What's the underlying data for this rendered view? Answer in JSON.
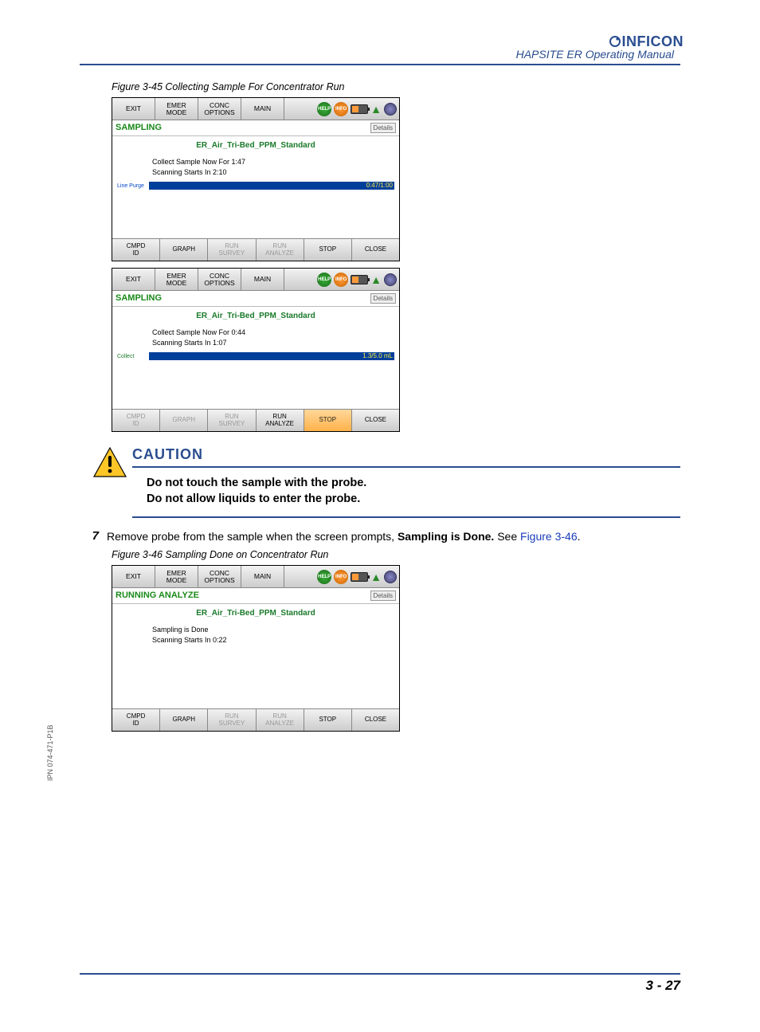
{
  "header": {
    "doc_title": "HAPSITE ER Operating Manual",
    "brand": "INFICON"
  },
  "fig45": {
    "caption": "Figure 3-45  Collecting Sample For Concentrator Run",
    "top_tabs": [
      "EXIT",
      "EMER\nMODE",
      "CONC\nOPTIONS",
      "MAIN"
    ],
    "details_label": "Details",
    "method": "ER_Air_Tri-Bed_PPM_Standard",
    "bottom_tabs": {
      "cmpd_id": "CMPD\nID",
      "graph": "GRAPH",
      "run_survey": "RUN\nSURVEY",
      "run_analyze": "RUN\nANALYZE",
      "stop": "STOP",
      "close": "CLOSE"
    },
    "shot_a": {
      "status": "SAMPLING",
      "line1": "Collect Sample Now For  1:47",
      "line2": "Scanning Starts In  2:10",
      "prog_label": "Line Purge",
      "prog_readout": "0:47/1:00"
    },
    "shot_b": {
      "status": "SAMPLING",
      "line1": "Collect Sample Now For  0:44",
      "line2": "Scanning Starts In  1:07",
      "prog_label": "Collect",
      "prog_readout": "1.3/5.0 mL"
    }
  },
  "caution": {
    "title": "CAUTION",
    "line1": "Do not touch the sample with the probe.",
    "line2": "Do not allow liquids to enter the probe."
  },
  "step7": {
    "num": "7",
    "text_pre": "Remove probe from the sample when the screen prompts, ",
    "text_bold": "Sampling is Done.",
    "text_after": " See ",
    "link": "Figure 3-46",
    "text_end": "."
  },
  "fig46": {
    "caption": "Figure 3-46  Sampling Done on Concentrator Run",
    "status": "RUNNING ANALYZE",
    "line1": "Sampling is Done",
    "line2": "Scanning Starts In  0:22"
  },
  "side_text": "IPN 074-471-P1B",
  "page_num": "3 - 27"
}
